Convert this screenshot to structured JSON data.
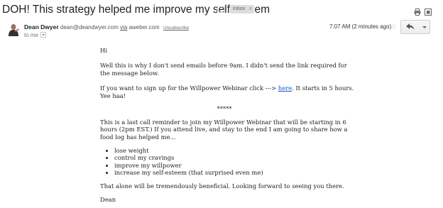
{
  "header": {
    "subject": "DOH! This strategy helped me improve my self-esteem",
    "label_badge": "Inbox",
    "label_remove": "x"
  },
  "sender": {
    "name": "Dean Dwyer",
    "email": "dean@deandwyer.com",
    "via_label": "via",
    "via_domain": "aweber.com",
    "unsubscribe": "Unsubscribe",
    "to": "to me",
    "timestamp": "7:07 AM (2 minutes ago)"
  },
  "email_body": {
    "greeting": "Hi",
    "p1": "Well this is why I don't send emails before 9am. I didn't send the link required for the message below.",
    "p2_before": "If you want to sign up for the Willpower Webinar click ---> ",
    "p2_link": "here",
    "p2_after": ". It starts in 5 hours. Yee haa!",
    "separator": "*****",
    "p3": "This is a last call reminder to join my Willpower Webinar that will be starting in 6 hours (2pm EST.) If you attend live, and stay to the end I am going to share how a food log has helped me...",
    "benefits": [
      "lose weight",
      "control my cravings",
      "improve my willpower",
      "increase my self-esteem (that surprised even me)"
    ],
    "p4": "That alone will be tremendously beneficial. Looking forward to seeing you there.",
    "signature": "Dean"
  },
  "icons": {
    "print": "print-icon",
    "new_window": "new-window-icon",
    "star": "star-icon",
    "reply": "reply-arrow-icon",
    "more": "chevron-down-icon"
  }
}
